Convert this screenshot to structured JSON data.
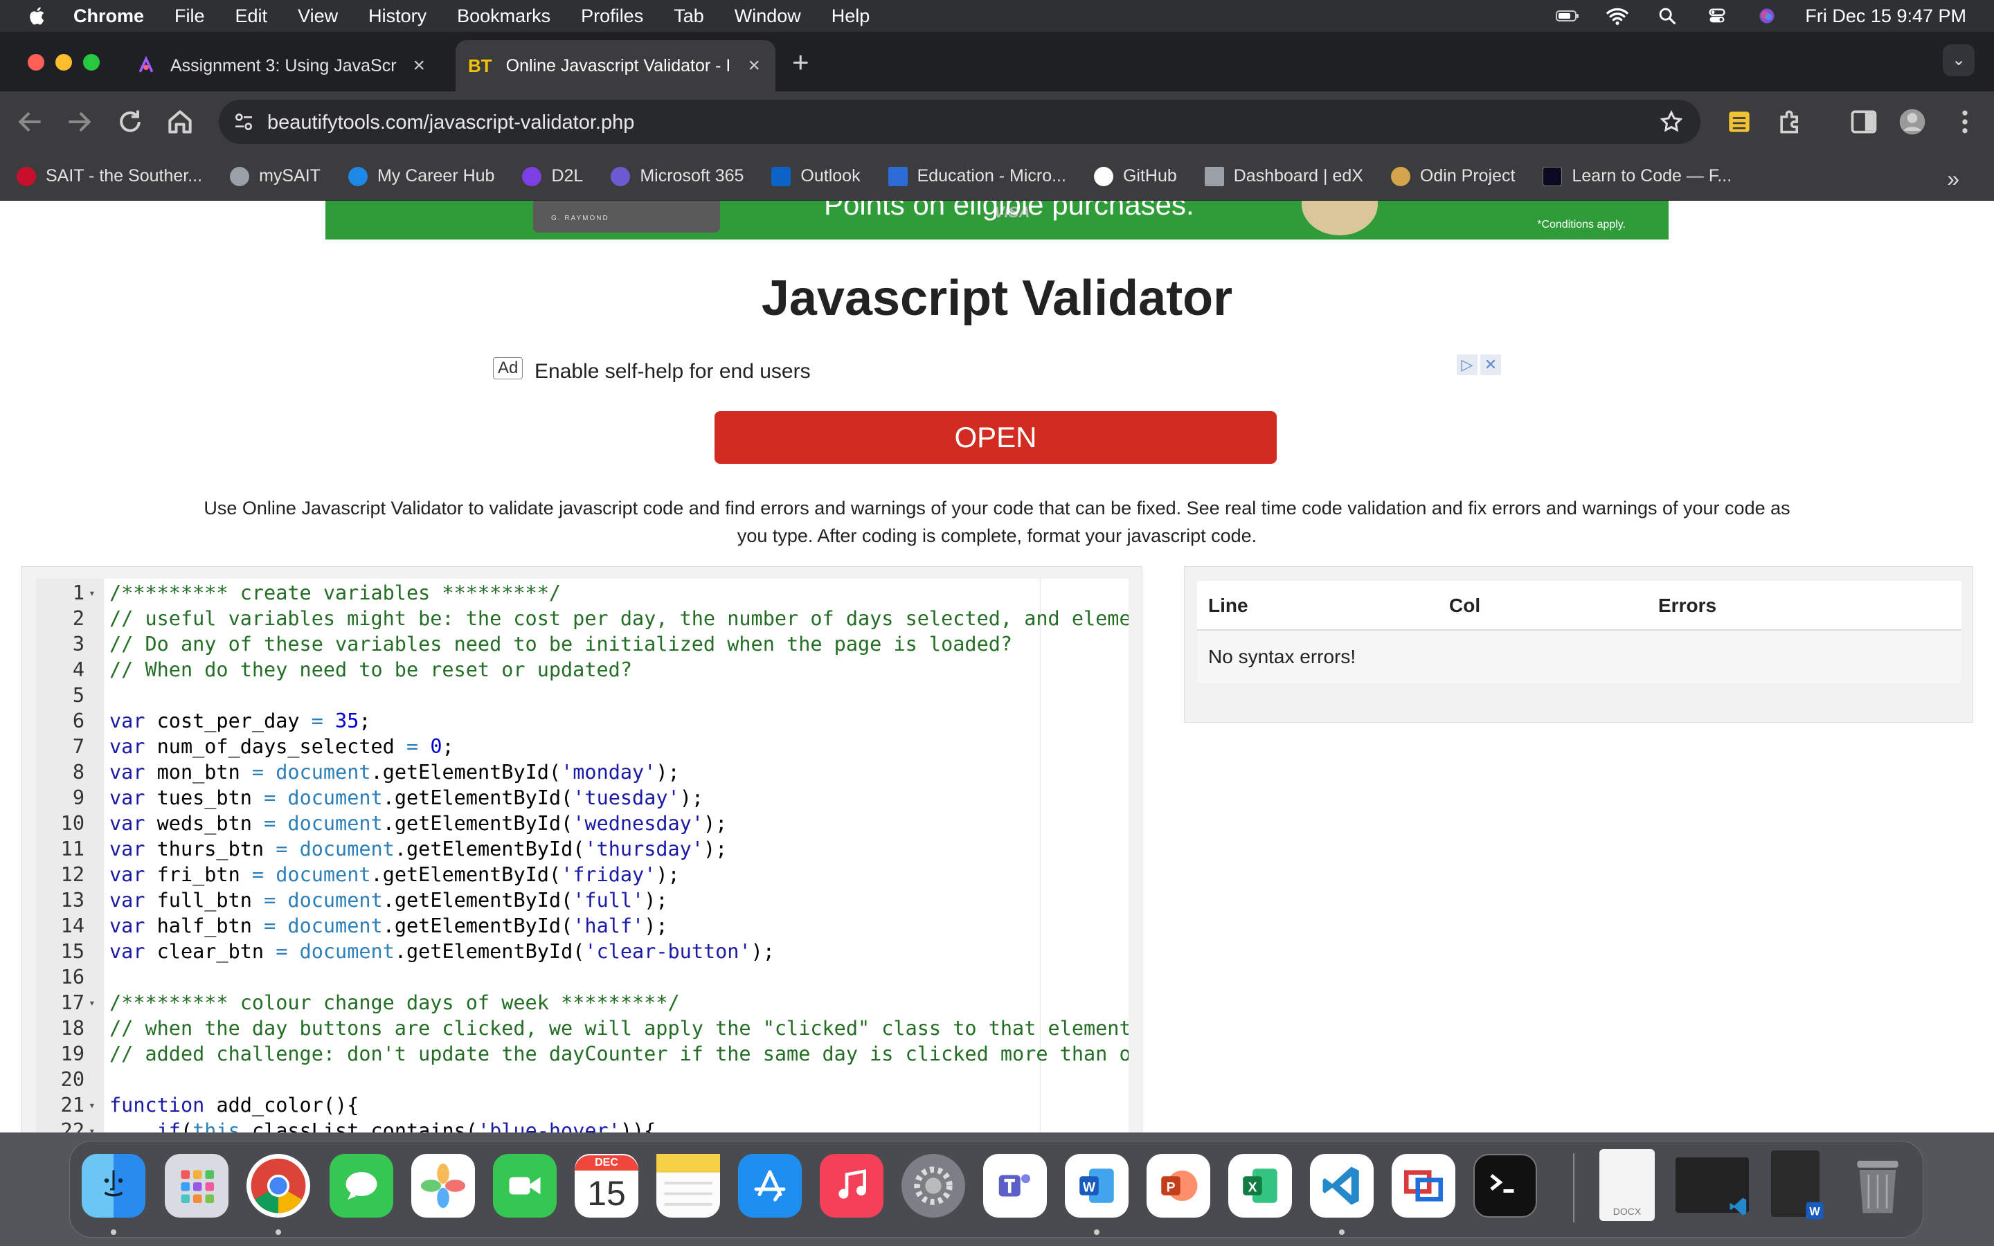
{
  "menubar": {
    "app_name": "Chrome",
    "menus": [
      "File",
      "Edit",
      "View",
      "History",
      "Bookmarks",
      "Profiles",
      "Tab",
      "Window",
      "Help"
    ],
    "datetime": "Fri Dec 15  9:47 PM"
  },
  "tabs": [
    {
      "title": "Assignment 3: Using JavaScr",
      "favicon": "d2l-icon",
      "active": false
    },
    {
      "title": "Online Javascript Validator - I",
      "favicon": "bt-icon",
      "favicon_text": "BT",
      "active": true
    }
  ],
  "toolbar": {
    "url": "beautifytools.com/javascript-validator.php"
  },
  "bookmarks": [
    {
      "label": "SAIT - the Souther...",
      "icon": "sait-icon",
      "color": "#c8102e"
    },
    {
      "label": "mySAIT",
      "icon": "globe-icon",
      "color": "#9aa0a6"
    },
    {
      "label": "My Career Hub",
      "icon": "careerhub-icon",
      "color": "#1e88e5"
    },
    {
      "label": "D2L",
      "icon": "d2l-icon",
      "color": "#7b3fe4"
    },
    {
      "label": "Microsoft 365",
      "icon": "m365-icon",
      "color": "#6b5bd2"
    },
    {
      "label": "Outlook",
      "icon": "outlook-icon",
      "color": "#0a64c8"
    },
    {
      "label": "Education - Micro...",
      "icon": "microsoft-learn-icon",
      "color": "#2b6cd6"
    },
    {
      "label": "GitHub",
      "icon": "github-icon",
      "color": "#ffffff"
    },
    {
      "label": "Dashboard | edX",
      "icon": "edx-icon",
      "color": "#9aa0a6"
    },
    {
      "label": "Odin Project",
      "icon": "odin-icon",
      "color": "#d4a54a"
    },
    {
      "label": "Learn to Code — F...",
      "icon": "freecodecamp-icon",
      "color": "#0a0a23"
    }
  ],
  "banner": {
    "card_text": "G. RAYMOND",
    "visa": "VISA",
    "promo": "Points on eligible purchases.",
    "conditions": "*Conditions apply."
  },
  "page": {
    "title": "Javascript Validator",
    "ad": {
      "tag": "Ad",
      "headline": "Enable self-help for end users",
      "button": "OPEN"
    },
    "description": "Use Online Javascript Validator to validate javascript code and find errors and warnings of your code that can be fixed. See real time code validation and fix errors and warnings of your code as you type. After coding is complete, format your javascript code."
  },
  "editor": {
    "lines": [
      {
        "n": "1",
        "fold": true,
        "tokens": [
          {
            "t": "/********* create variables *********/",
            "c": "com"
          }
        ]
      },
      {
        "n": "2",
        "tokens": [
          {
            "t": "// useful variables might be: the cost per day, the number of days selected, and element",
            "c": "com"
          }
        ]
      },
      {
        "n": "3",
        "tokens": [
          {
            "t": "// Do any of these variables need to be initialized when the page is loaded?",
            "c": "com"
          }
        ]
      },
      {
        "n": "4",
        "tokens": [
          {
            "t": "// When do they need to be reset or updated?",
            "c": "com"
          }
        ]
      },
      {
        "n": "5",
        "tokens": []
      },
      {
        "n": "6",
        "tokens": [
          {
            "t": "var",
            "c": "kw"
          },
          {
            "t": " cost_per_day ",
            "c": ""
          },
          {
            "t": "=",
            "c": "obj"
          },
          {
            "t": " ",
            "c": ""
          },
          {
            "t": "35",
            "c": "num"
          },
          {
            "t": ";",
            "c": ""
          }
        ]
      },
      {
        "n": "7",
        "tokens": [
          {
            "t": "var",
            "c": "kw"
          },
          {
            "t": " num_of_days_selected ",
            "c": ""
          },
          {
            "t": "=",
            "c": "obj"
          },
          {
            "t": " ",
            "c": ""
          },
          {
            "t": "0",
            "c": "num"
          },
          {
            "t": ";",
            "c": ""
          }
        ]
      },
      {
        "n": "8",
        "tokens": [
          {
            "t": "var",
            "c": "kw"
          },
          {
            "t": " mon_btn ",
            "c": ""
          },
          {
            "t": "=",
            "c": "obj"
          },
          {
            "t": " ",
            "c": ""
          },
          {
            "t": "document",
            "c": "obj"
          },
          {
            "t": ".getElementById(",
            "c": ""
          },
          {
            "t": "'monday'",
            "c": "str"
          },
          {
            "t": ");",
            "c": ""
          }
        ]
      },
      {
        "n": "9",
        "tokens": [
          {
            "t": "var",
            "c": "kw"
          },
          {
            "t": " tues_btn ",
            "c": ""
          },
          {
            "t": "=",
            "c": "obj"
          },
          {
            "t": " ",
            "c": ""
          },
          {
            "t": "document",
            "c": "obj"
          },
          {
            "t": ".getElementById(",
            "c": ""
          },
          {
            "t": "'tuesday'",
            "c": "str"
          },
          {
            "t": ");",
            "c": ""
          }
        ]
      },
      {
        "n": "10",
        "tokens": [
          {
            "t": "var",
            "c": "kw"
          },
          {
            "t": " weds_btn ",
            "c": ""
          },
          {
            "t": "=",
            "c": "obj"
          },
          {
            "t": " ",
            "c": ""
          },
          {
            "t": "document",
            "c": "obj"
          },
          {
            "t": ".getElementById(",
            "c": ""
          },
          {
            "t": "'wednesday'",
            "c": "str"
          },
          {
            "t": ");",
            "c": ""
          }
        ]
      },
      {
        "n": "11",
        "tokens": [
          {
            "t": "var",
            "c": "kw"
          },
          {
            "t": " thurs_btn ",
            "c": ""
          },
          {
            "t": "=",
            "c": "obj"
          },
          {
            "t": " ",
            "c": ""
          },
          {
            "t": "document",
            "c": "obj"
          },
          {
            "t": ".getElementById(",
            "c": ""
          },
          {
            "t": "'thursday'",
            "c": "str"
          },
          {
            "t": ");",
            "c": ""
          }
        ]
      },
      {
        "n": "12",
        "tokens": [
          {
            "t": "var",
            "c": "kw"
          },
          {
            "t": " fri_btn ",
            "c": ""
          },
          {
            "t": "=",
            "c": "obj"
          },
          {
            "t": " ",
            "c": ""
          },
          {
            "t": "document",
            "c": "obj"
          },
          {
            "t": ".getElementById(",
            "c": ""
          },
          {
            "t": "'friday'",
            "c": "str"
          },
          {
            "t": ");",
            "c": ""
          }
        ]
      },
      {
        "n": "13",
        "tokens": [
          {
            "t": "var",
            "c": "kw"
          },
          {
            "t": " full_btn ",
            "c": ""
          },
          {
            "t": "=",
            "c": "obj"
          },
          {
            "t": " ",
            "c": ""
          },
          {
            "t": "document",
            "c": "obj"
          },
          {
            "t": ".getElementById(",
            "c": ""
          },
          {
            "t": "'full'",
            "c": "str"
          },
          {
            "t": ");",
            "c": ""
          }
        ]
      },
      {
        "n": "14",
        "tokens": [
          {
            "t": "var",
            "c": "kw"
          },
          {
            "t": " half_btn ",
            "c": ""
          },
          {
            "t": "=",
            "c": "obj"
          },
          {
            "t": " ",
            "c": ""
          },
          {
            "t": "document",
            "c": "obj"
          },
          {
            "t": ".getElementById(",
            "c": ""
          },
          {
            "t": "'half'",
            "c": "str"
          },
          {
            "t": ");",
            "c": ""
          }
        ]
      },
      {
        "n": "15",
        "tokens": [
          {
            "t": "var",
            "c": "kw"
          },
          {
            "t": " clear_btn ",
            "c": ""
          },
          {
            "t": "=",
            "c": "obj"
          },
          {
            "t": " ",
            "c": ""
          },
          {
            "t": "document",
            "c": "obj"
          },
          {
            "t": ".getElementById(",
            "c": ""
          },
          {
            "t": "'clear-button'",
            "c": "str"
          },
          {
            "t": ");",
            "c": ""
          }
        ]
      },
      {
        "n": "16",
        "tokens": []
      },
      {
        "n": "17",
        "fold": true,
        "tokens": [
          {
            "t": "/********* colour change days of week *********/",
            "c": "com"
          }
        ]
      },
      {
        "n": "18",
        "tokens": [
          {
            "t": "// when the day buttons are clicked, we will apply the \"clicked\" class to that element,",
            "c": "com"
          }
        ]
      },
      {
        "n": "19",
        "tokens": [
          {
            "t": "// added challenge: don't update the dayCounter if the same day is clicked more than onc",
            "c": "com"
          }
        ]
      },
      {
        "n": "20",
        "tokens": []
      },
      {
        "n": "21",
        "fold": true,
        "tokens": [
          {
            "t": "function",
            "c": "kw"
          },
          {
            "t": " add_color(){",
            "c": ""
          }
        ]
      },
      {
        "n": "22",
        "fold": true,
        "tokens": [
          {
            "t": "    ",
            "c": ""
          },
          {
            "t": "if",
            "c": "kw"
          },
          {
            "t": "(",
            "c": ""
          },
          {
            "t": "this",
            "c": "obj"
          },
          {
            "t": ".classList.contains(",
            "c": ""
          },
          {
            "t": "'blue-hover'",
            "c": "str"
          },
          {
            "t": ")){",
            "c": ""
          }
        ]
      }
    ]
  },
  "results": {
    "columns": [
      "Line",
      "Col",
      "Errors"
    ],
    "message": "No syntax errors!"
  },
  "dock": {
    "calendar_month": "DEC",
    "calendar_day": "15",
    "docx_label": "DOCX",
    "apps": [
      "Finder",
      "Launchpad",
      "Google Chrome",
      "Messages",
      "Photos",
      "FaceTime",
      "Calendar",
      "Notes",
      "App Store",
      "Music",
      "System Settings",
      "Microsoft Teams",
      "Microsoft Word",
      "Microsoft PowerPoint",
      "Microsoft Excel",
      "Visual Studio Code",
      "Remote Desktop",
      "Terminal"
    ]
  }
}
